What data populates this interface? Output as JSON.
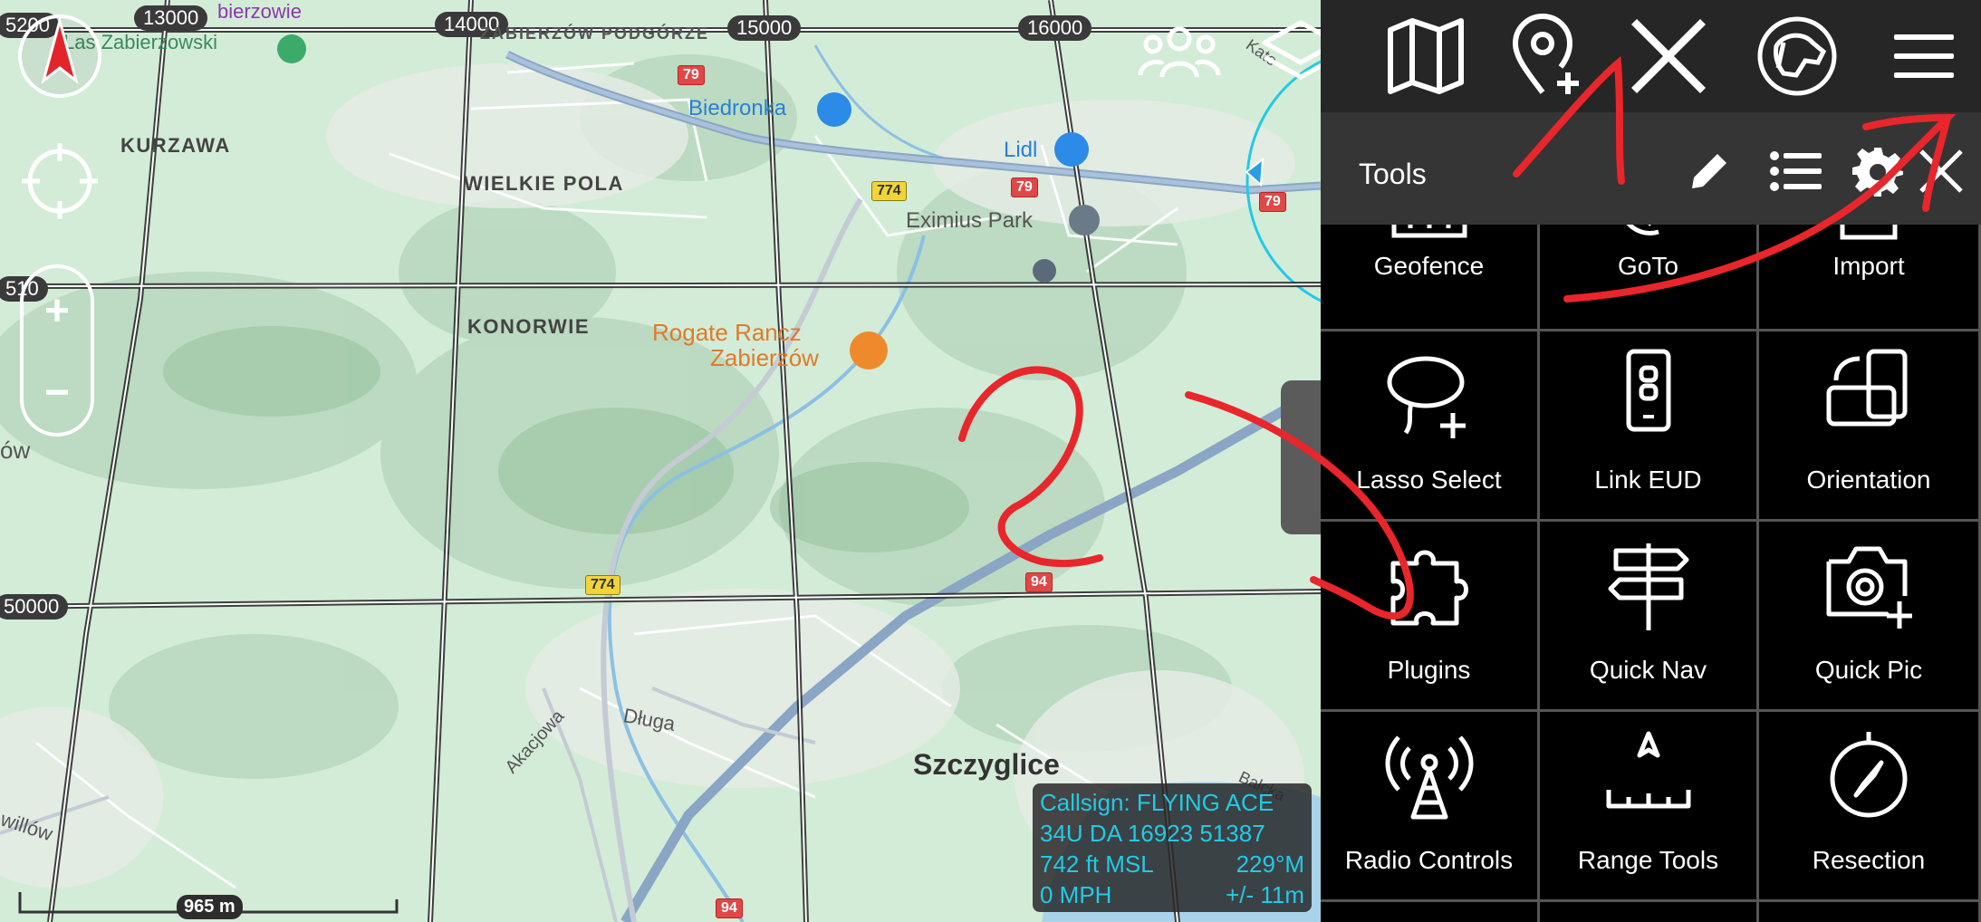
{
  "map": {
    "grid_x_labels": [
      "13000",
      "14000",
      "15000",
      "16000"
    ],
    "grid_y_labels": [
      "5200",
      "510",
      "50000"
    ],
    "places": {
      "kurzawa": "KURZAWA",
      "wielkie_pola": "WIELKIE POLA",
      "konorwie": "KONORWIE",
      "szczyglice": "Szczyglice",
      "eximius": "Eximius Park",
      "biedronka": "Biedronka",
      "lidl": "Lidl",
      "rogate_line1": "Rogate Rancz",
      "rogate_line2": "Zabierzów",
      "lasek": "Las Zabierzowski",
      "zabierzowie": "bierzowie",
      "podgorze": "ZABIERZÓW PODGÓRZE",
      "akacjowa": "Akacjowa",
      "dluga": "Długa",
      "willowa": "willów",
      "ow": "ów",
      "kato": "Kato",
      "balcka": "Balcka"
    },
    "road_shields": [
      "79",
      "79",
      "79",
      "774",
      "774",
      "94",
      "94"
    ],
    "info": {
      "callsign": "Callsign: FLYING ACE",
      "grid_ref": "34U  DA  16923  51387",
      "altitude": "742 ft MSL",
      "heading": "229°M",
      "speed": "0 MPH",
      "accuracy": "+/- 11m"
    },
    "scale": "965 m",
    "zoom_in": "+",
    "zoom_out": "−"
  },
  "toolbar": {
    "icons": [
      "team-icon",
      "layers-icon",
      "map-icon",
      "add-point-icon",
      "close-x-icon",
      "dog-icon",
      "menu-icon"
    ]
  },
  "tools_panel": {
    "title": "Tools",
    "tools": [
      {
        "label": "Geofence",
        "icon": "geofence-icon"
      },
      {
        "label": "GoTo",
        "icon": "goto-icon"
      },
      {
        "label": "Import",
        "icon": "import-icon"
      },
      {
        "label": "Lasso Select",
        "icon": "lasso-icon"
      },
      {
        "label": "Link EUD",
        "icon": "link-phone-icon"
      },
      {
        "label": "Orientation",
        "icon": "orientation-icon"
      },
      {
        "label": "Plugins",
        "icon": "puzzle-icon"
      },
      {
        "label": "Quick Nav",
        "icon": "signpost-icon"
      },
      {
        "label": "Quick Pic",
        "icon": "camera-plus-icon"
      },
      {
        "label": "Radio Controls",
        "icon": "radio-tower-icon"
      },
      {
        "label": "Range Tools",
        "icon": "range-icon"
      },
      {
        "label": "Resection",
        "icon": "compass-icon"
      }
    ]
  },
  "colors": {
    "accent_cyan": "#23c9e6",
    "annotation_red": "#e8262b",
    "panel_bg": "#000000",
    "toolbar_bg": "#262626"
  }
}
